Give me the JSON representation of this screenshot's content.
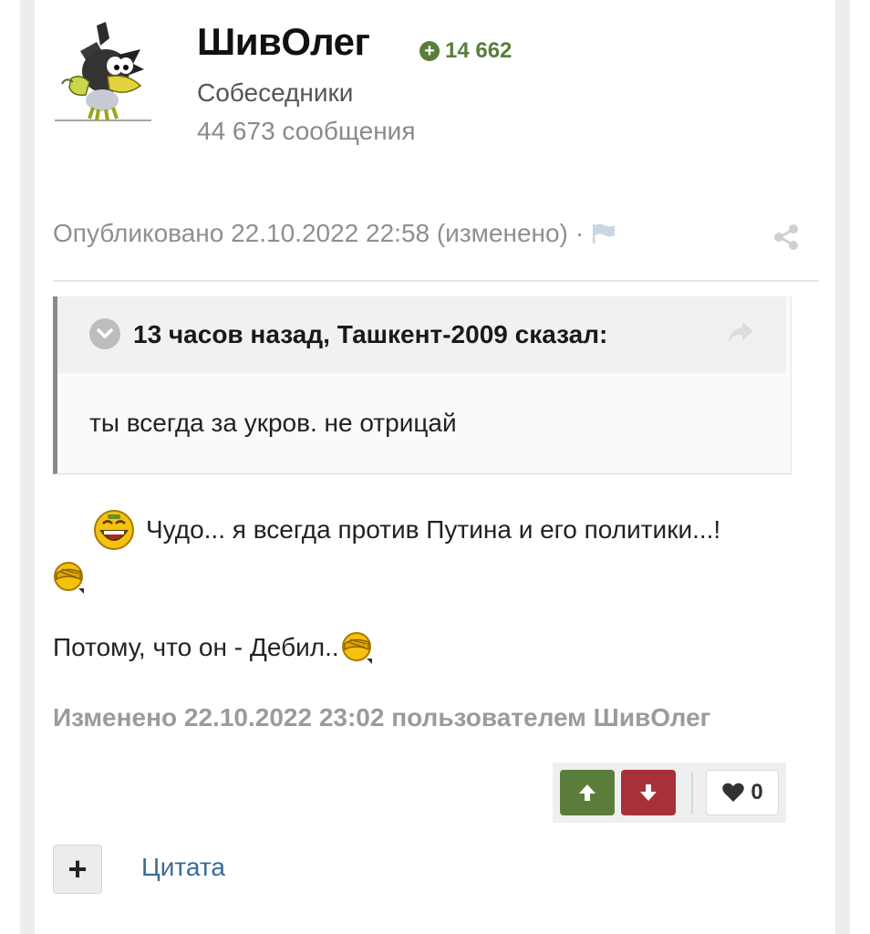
{
  "author": {
    "name": "ШивОлег",
    "reputation": "14 662",
    "group": "Собеседники",
    "posts": "44 673 сообщения"
  },
  "meta": {
    "published": "Опубликовано 22.10.2022 22:58 (изменено)",
    "separator": "·"
  },
  "quote": {
    "header": "13 часов назад, Ташкент-2009 сказал:",
    "text": "ты всегда за укров. не отрицай"
  },
  "post": {
    "line1": "Чудо... я всегда против Путина и его политики...!",
    "line2": "Потому, что он - Дебил.."
  },
  "edited_note": "Изменено 22.10.2022 23:02 пользователем ШивОлег",
  "reactions": {
    "like_count": "0"
  },
  "actions": {
    "plus": "+",
    "quote": "Цитата"
  },
  "colors": {
    "reputation": "#5b7d3c",
    "upvote": "#5b7d3c",
    "downvote": "#a8303a",
    "link": "#3a6a95"
  },
  "icons": [
    "avatar-crow",
    "plus-circle-icon",
    "flag-icon",
    "share-icon",
    "chevron-down-icon",
    "reply-arrow-icon",
    "laughing-smiley",
    "facepalm-smiley",
    "arrow-up-icon",
    "arrow-down-icon",
    "heart-icon"
  ]
}
